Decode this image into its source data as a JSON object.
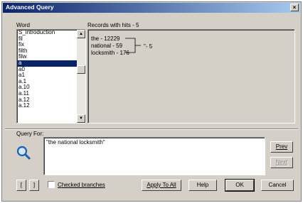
{
  "window": {
    "title": "Advanced Query",
    "close": "×"
  },
  "word_label": "Word",
  "records_label": "Records with hits - 5",
  "words": [
    "S_introduction",
    "fil",
    "fix",
    "filth",
    "filw",
    "a",
    "a0",
    "a1",
    "a.1",
    "a.10",
    "a.11",
    "a.12",
    "a.12"
  ],
  "selected_word_index": 5,
  "records": {
    "lines": [
      "the - 12229",
      "national - 59",
      "locksmith - 176"
    ],
    "result": "\"- 5"
  },
  "query_label": "Query For:",
  "query_text": "\"the national locksmith\"",
  "buttons": {
    "prev": "Prev",
    "next": "Next",
    "left": "[",
    "right": "]",
    "checked_branches": "Checked branches",
    "apply_to_all": "Apply To All",
    "help": "Help",
    "ok": "OK",
    "cancel": "Cancel"
  },
  "icons": {
    "search": "magnifier-icon"
  }
}
